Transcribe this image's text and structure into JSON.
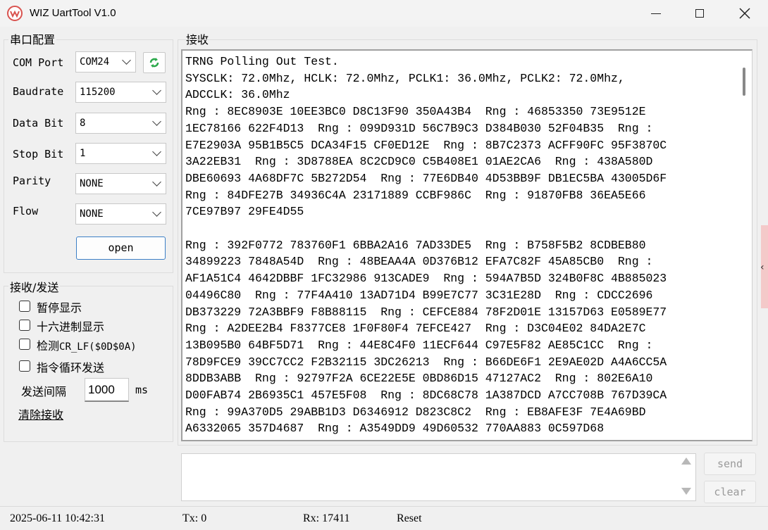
{
  "window": {
    "title": "WIZ UartTool V1.0",
    "icon": "wiz-logo-icon",
    "controls": [
      "minimize-icon",
      "maximize-icon",
      "close-icon"
    ]
  },
  "serial_config": {
    "group_title": "串口配置",
    "com_port": {
      "label": "COM Port",
      "value": "COM24"
    },
    "baudrate": {
      "label": "Baudrate",
      "value": "115200"
    },
    "data_bit": {
      "label": "Data Bit",
      "value": "8"
    },
    "stop_bit": {
      "label": "Stop Bit",
      "value": "1"
    },
    "parity": {
      "label": "Parity",
      "value": "NONE"
    },
    "flow": {
      "label": "Flow",
      "value": "NONE"
    },
    "open_button": "open",
    "refresh_icon": "refresh-icon"
  },
  "rx_tx": {
    "group_title": "接收/发送",
    "checkboxes": [
      {
        "label": "暂停显示",
        "checked": false
      },
      {
        "label": "十六进制显示",
        "checked": false
      },
      {
        "label_prefix": "检测",
        "label_mono": "CR_LF($0D$0A)",
        "checked": false
      },
      {
        "label": "指令循环发送",
        "checked": false
      }
    ],
    "interval_label": "发送间隔",
    "interval_value": "1000",
    "interval_unit": "ms",
    "clear_receive": "清除接收"
  },
  "receive": {
    "title": "接收",
    "text": "TRNG Polling Out Test.\nSYSCLK: 72.0Mhz, HCLK: 72.0Mhz, PCLK1: 36.0Mhz, PCLK2: 72.0Mhz,\nADCCLK: 36.0Mhz\nRng : 8EC8903E 10EE3BC0 D8C13F90 350A43B4  Rng : 46853350 73E9512E\n1EC78166 622F4D13  Rng : 099D931D 56C7B9C3 D384B030 52F04B35  Rng :\nE7E2903A 95B1B5C5 DCA34F15 CF0ED12E  Rng : 8B7C2373 ACFF90FC 95F3870C\n3A22EB31  Rng : 3D8788EA 8C2CD9C0 C5B408E1 01AE2CA6  Rng : 438A580D\nDBE60693 4A68DF7C 5B272D54  Rng : 77E6DB40 4D53BB9F DB1EC5BA 43005D6F\nRng : 84DFE27B 34936C4A 23171889 CCBF986C  Rng : 91870FB8 36EA5E66\n7CE97B97 29FE4D55\n\nRng : 392F0772 783760F1 6BBA2A16 7AD33DE5  Rng : B758F5B2 8CDBEB80\n34899223 7848A54D  Rng : 48BEAA4A 0D376B12 EFA7C82F 45A85CB0  Rng :\nAF1A51C4 4642DBBF 1FC32986 913CADE9  Rng : 594A7B5D 324B0F8C 4B885023\n04496C80  Rng : 77F4A410 13AD71D4 B99E7C77 3C31E28D  Rng : CDCC2696\nDB373229 72A3BBF9 F8B88115  Rng : CEFCE884 78F2D01E 13157D63 E0589E77\nRng : A2DEE2B4 F8377CE8 1F0F80F4 7EFCE427  Rng : D3C04E02 84DA2E7C\n13B095B0 64BF5D71  Rng : 44E8C4F0 11ECF644 C97E5F82 AE85C1CC  Rng :\n78D9FCE9 39CC7CC2 F2B32115 3DC26213  Rng : B66DE6F1 2E9AE02D A4A6CC5A\n8DDB3ABB  Rng : 92797F2A 6CE22E5E 0BD86D15 47127AC2  Rng : 802E6A10\nD00FAB74 2B6935C1 457E5F08  Rng : 8DC68C78 1A387DCD A7CC708B 767D39CA\nRng : 99A370D5 29ABB1D3 D6346912 D823C8C2  Rng : EB8AFE3F 7E4A69BD\nA6332065 357D4687  Rng : A3549DD9 49D60532 770AA883 0C597D68"
  },
  "send": {
    "send_button": "send",
    "clear_button": "clear",
    "input_value": ""
  },
  "status": {
    "datetime": "2025-06-11 10:42:31",
    "tx": "Tx: 0",
    "rx": "Rx: 17411",
    "reset": "Reset"
  }
}
